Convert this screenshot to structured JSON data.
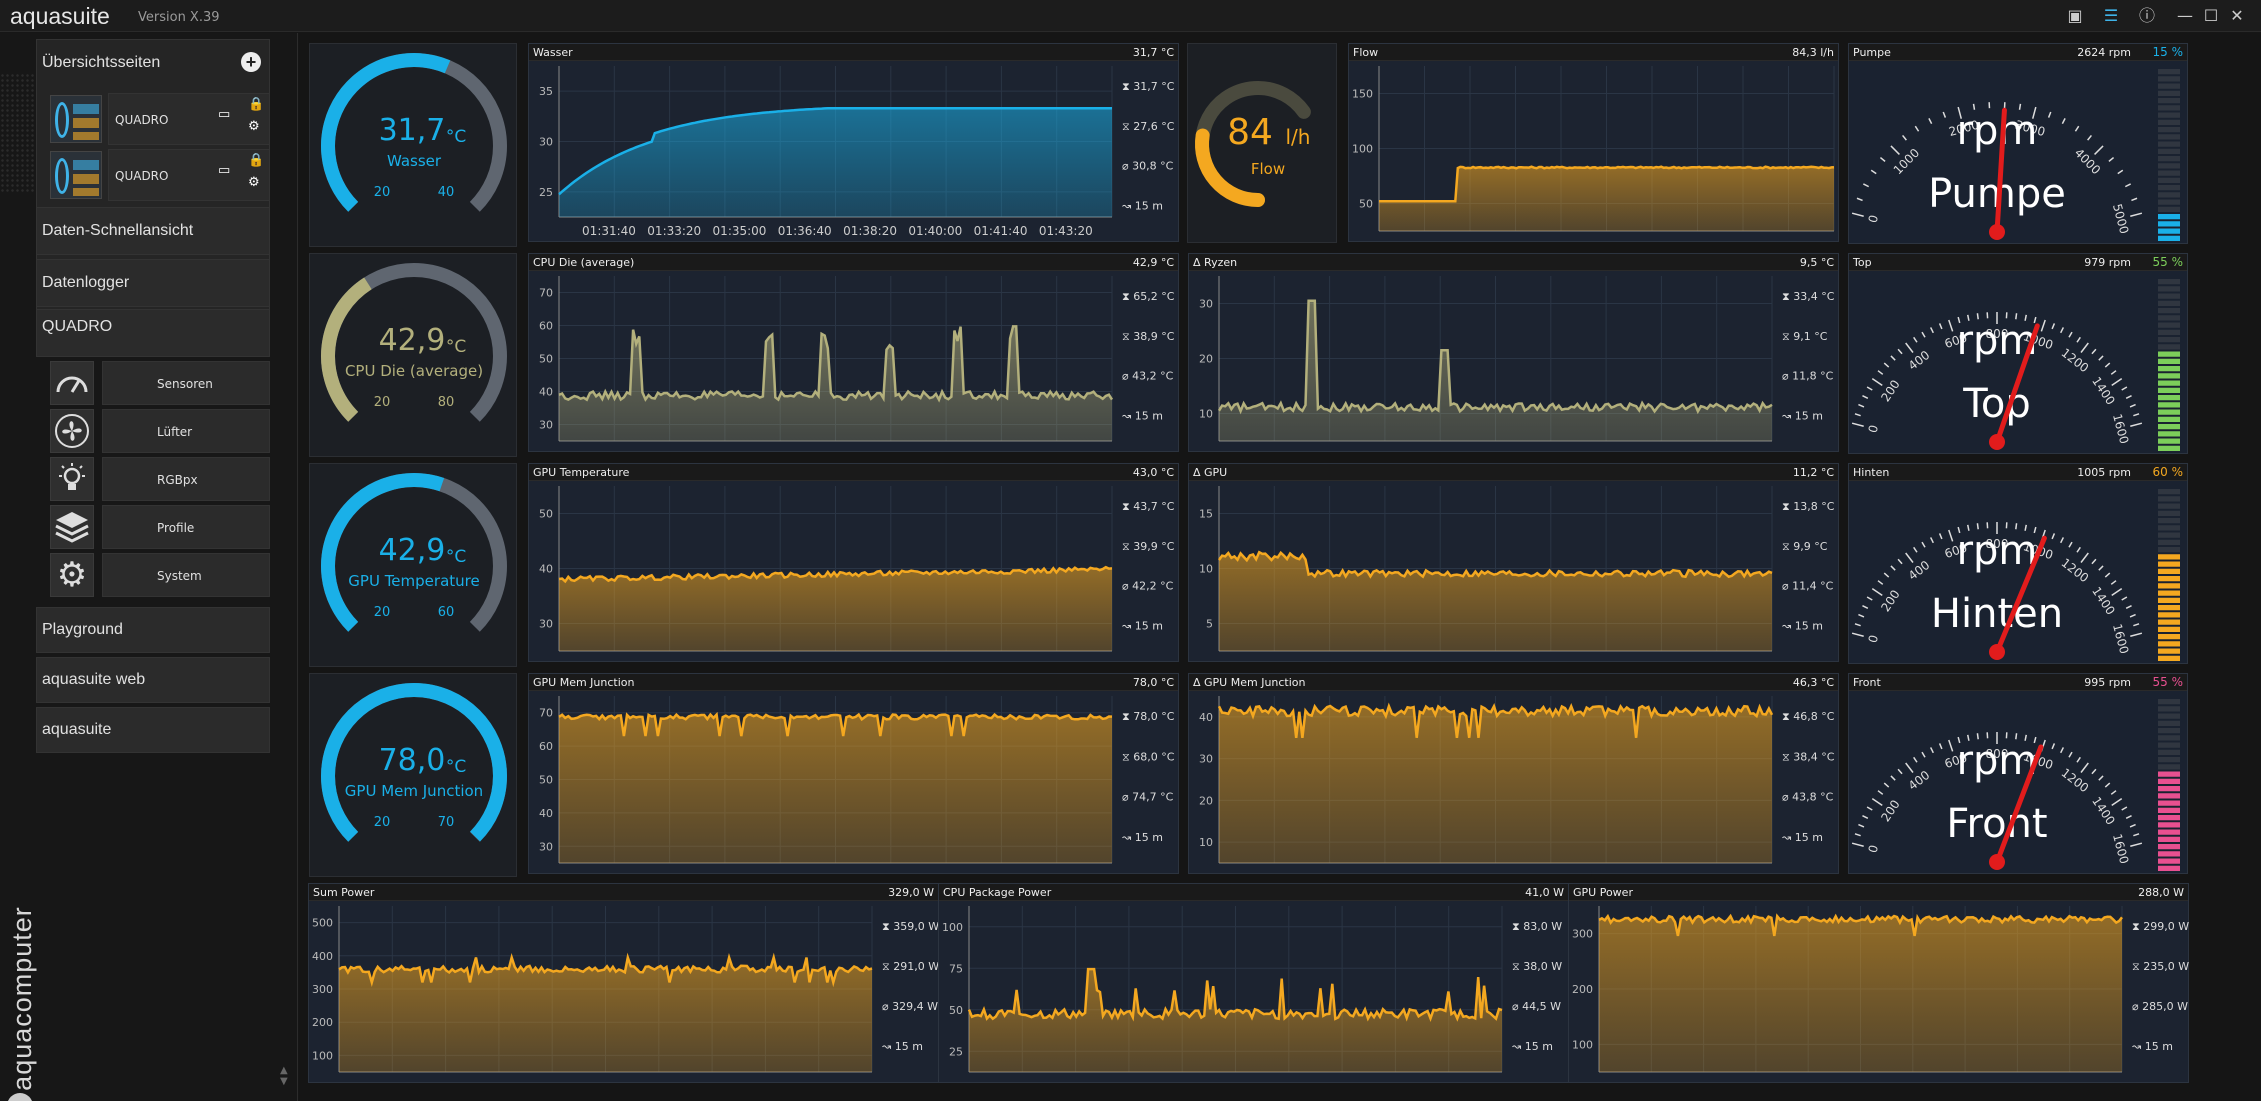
{
  "app": {
    "name": "aquasuite",
    "version": "Version X.39",
    "brand": "aquacomputer"
  },
  "colors": {
    "blue": "#1ab0e8",
    "orange": "#f4a820",
    "olive": "#b3b07c",
    "red": "#e21c1c",
    "green": "#7cce5a",
    "pink": "#e85090"
  },
  "sidebar": {
    "overview_label": "Übersichtsseiten",
    "pages": [
      {
        "label": "QUADRO"
      },
      {
        "label": "QUADRO"
      }
    ],
    "items": [
      "Daten-Schnellansicht",
      "Datenlogger",
      "QUADRO"
    ],
    "quadro_sub": [
      {
        "label": "Sensoren",
        "icon": "gauge-icon"
      },
      {
        "label": "Lüfter",
        "icon": "fan-icon"
      },
      {
        "label": "RGBpx",
        "icon": "bulb-icon"
      },
      {
        "label": "Profile",
        "icon": "layers-icon"
      },
      {
        "label": "System",
        "icon": "gear-icon"
      }
    ],
    "bottom_items": [
      "Playground",
      "aquasuite web",
      "aquasuite"
    ]
  },
  "gauges": [
    {
      "value": "31,7",
      "unit": "°C",
      "label": "Wasser",
      "min": "20",
      "max": "40",
      "color": "#1ab0e8",
      "fill": 0.585
    },
    {
      "value": "42,9",
      "unit": "°C",
      "label": "CPU Die (average)",
      "min": "20",
      "max": "80",
      "color": "#b3b07c",
      "fill": 0.38
    },
    {
      "value": "42,9",
      "unit": "°C",
      "label": "GPU Temperature",
      "min": "20",
      "max": "60",
      "color": "#1ab0e8",
      "fill": 0.57
    },
    {
      "value": "78,0",
      "unit": "°C",
      "label": "GPU Mem Junction",
      "min": "20",
      "max": "70",
      "color": "#1ab0e8",
      "fill": 1.0
    }
  ],
  "flow_gauge": {
    "value": "84",
    "unit": "l/h",
    "label": "Flow",
    "fill": 0.42
  },
  "charts": [
    {
      "title": "Wasser",
      "current": "31,7 °C",
      "stats": [
        "31,7 °C",
        "27,6 °C",
        "30,8 °C",
        "15 m"
      ],
      "yticks": [
        "35",
        "30",
        "25"
      ],
      "xticks": [
        "01:31:40",
        "01:33:20",
        "01:35:00",
        "01:36:40",
        "01:38:20",
        "01:40:00",
        "01:41:40",
        "01:43:20"
      ],
      "color": "#1ab0e8"
    },
    {
      "title": "Flow",
      "current": "84,3 l/h",
      "yticks": [
        "150",
        "100",
        "50"
      ],
      "color": "#f4a820"
    },
    {
      "title": "CPU Die (average)",
      "current": "42,9 °C",
      "stats": [
        "65,2 °C",
        "38,9 °C",
        "43,2 °C",
        "15 m"
      ],
      "yticks": [
        "70",
        "60",
        "50",
        "40",
        "30"
      ],
      "color": "#b3b07c"
    },
    {
      "title": "Δ Ryzen",
      "current": "9,5 °C",
      "stats": [
        "33,4 °C",
        "9,1 °C",
        "11,8 °C",
        "15 m"
      ],
      "yticks": [
        "30",
        "20",
        "10"
      ],
      "color": "#b3b07c"
    },
    {
      "title": "GPU Temperature",
      "current": "43,0 °C",
      "stats": [
        "43,7 °C",
        "39,9 °C",
        "42,2 °C",
        "15 m"
      ],
      "yticks": [
        "50",
        "40",
        "30"
      ],
      "color": "#f4a820"
    },
    {
      "title": "Δ GPU",
      "current": "11,2 °C",
      "stats": [
        "13,8 °C",
        "9,9 °C",
        "11,4 °C",
        "15 m"
      ],
      "yticks": [
        "15",
        "10",
        "5"
      ],
      "color": "#f4a820"
    },
    {
      "title": "GPU Mem Junction",
      "current": "78,0 °C",
      "stats": [
        "78,0 °C",
        "68,0 °C",
        "74,7 °C",
        "15 m"
      ],
      "yticks": [
        "70",
        "60",
        "50",
        "40",
        "30"
      ],
      "color": "#f4a820"
    },
    {
      "title": "Δ GPU Mem Junction",
      "current": "46,3 °C",
      "stats": [
        "46,8 °C",
        "38,4 °C",
        "43,8 °C",
        "15 m"
      ],
      "yticks": [
        "40",
        "30",
        "20",
        "10"
      ],
      "color": "#f4a820"
    },
    {
      "title": "Sum Power",
      "current": "329,0 W",
      "stats": [
        "359,0 W",
        "291,0 W",
        "329,4 W",
        "15 m"
      ],
      "yticks": [
        "500",
        "400",
        "300",
        "200",
        "100"
      ],
      "color": "#f4a820"
    },
    {
      "title": "CPU Package Power",
      "current": "41,0 W",
      "stats": [
        "83,0 W",
        "38,0 W",
        "44,5 W",
        "15 m"
      ],
      "yticks": [
        "100",
        "75",
        "50",
        "25"
      ],
      "color": "#f4a820"
    },
    {
      "title": "GPU Power",
      "current": "288,0 W",
      "stats": [
        "299,0 W",
        "235,0 W",
        "285,0 W",
        "15 m"
      ],
      "yticks": [
        "300",
        "200",
        "100"
      ],
      "color": "#f4a820"
    }
  ],
  "rpm_gauges": [
    {
      "title": "Pumpe",
      "rpm": "2624 rpm",
      "pct": "15 %",
      "label": "Pumpe",
      "unit": "rpm",
      "ticks": [
        "0",
        "1000",
        "2000",
        "3000",
        "4000",
        "5000"
      ],
      "pct_color": "#1ab0e8",
      "needle": 0.52,
      "bar_fill": 0.15
    },
    {
      "title": "Top",
      "rpm": "979 rpm",
      "pct": "55 %",
      "label": "Top",
      "unit": "rpm",
      "ticks": [
        "0",
        "200",
        "400",
        "600",
        "800",
        "1000",
        "1200",
        "1400",
        "1600"
      ],
      "pct_color": "#7cce5a",
      "needle": 0.61,
      "bar_fill": 0.55
    },
    {
      "title": "Hinten",
      "rpm": "1005 rpm",
      "pct": "60 %",
      "label": "Hinten",
      "unit": "rpm",
      "ticks": [
        "0",
        "200",
        "400",
        "600",
        "800",
        "1000",
        "1200",
        "1400",
        "1600"
      ],
      "pct_color": "#f4a820",
      "needle": 0.63,
      "bar_fill": 0.6
    },
    {
      "title": "Front",
      "rpm": "995 rpm",
      "pct": "55 %",
      "label": "Front",
      "unit": "rpm",
      "ticks": [
        "0",
        "200",
        "400",
        "600",
        "800",
        "1000",
        "1200",
        "1400",
        "1600"
      ],
      "pct_color": "#e85090",
      "needle": 0.62,
      "bar_fill": 0.55
    }
  ]
}
